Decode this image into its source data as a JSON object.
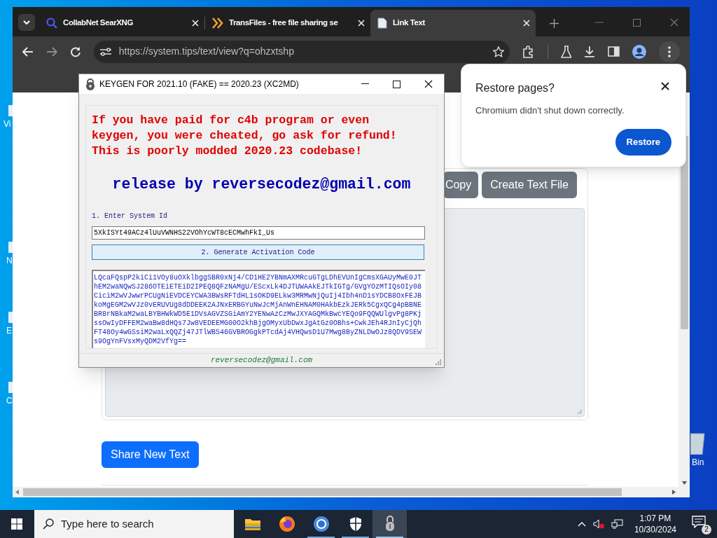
{
  "desktop": {
    "icons": [
      {
        "label": "Vi"
      },
      {
        "label": "N"
      },
      {
        "label": "E"
      },
      {
        "label": "C"
      },
      {
        "label": "Bin"
      }
    ]
  },
  "browser": {
    "tabs": [
      {
        "title": "CollabNet SearXNG",
        "kind": "search",
        "selected": false
      },
      {
        "title": "TransFiles - free file sharing se",
        "kind": "chevrons",
        "selected": false
      },
      {
        "title": "Link Text",
        "kind": "document",
        "selected": true
      }
    ],
    "address": "https://system.tips/text/view?q=ohzxtshp",
    "page": {
      "buttons": [
        "Copy",
        "Create Text File"
      ],
      "share_button": "Share New Text"
    }
  },
  "restore_popup": {
    "title": "Restore pages?",
    "message": "Chromium didn't shut down correctly.",
    "button": "Restore"
  },
  "keygen": {
    "title": "KEYGEN FOR 2021.10 (FAKE) == 2020.23 (XC2MD)",
    "warning": [
      "If you have paid for c4b program or even",
      "keygen, you were cheated, go ask for refund!",
      "This is poorly modded 2020.23 codebase!"
    ],
    "release": "release by reversecodez@gmail.com",
    "system_id_label": "1. Enter System Id",
    "system_id": "5XkISYt49ACz4lUuVWNHS22VOhYcWT8cECMwhFkI_Us",
    "generate_button": "2. Generate Activation Code",
    "activation_code": [
      "LQcaFQspP2kiCi1VOy8uOXklbggSBR0xNj4/CD1HE2YBNmAXMRcuGTgLDhEVUnIgCmsXGAUyMwE0JT",
      "hEM2waNQwSJ286OTEiETEiD2IPEQ8QFzNAMgU/EScxLk4DJTUWAAkEJTkIGTg/GVgYOzMTIQsOIy08",
      "CiciM2wVJwwrPCUgNiEVDCEYCWA3BWsRFTdHL1sOKD9ELkw3MRMwNjQuIj4Ibh4nD1sYDCB8OxFEJB",
      "koMgEGM2wVJz0vERUVUg8dDDEEK2AJNxERBGYuNwJcMjAnWnEHNAM0HAkbEzkJERk5CgxQCg4pBBNE",
      "BR8rNBkaM2waLBYBHWkWD5E1DVsAGVZSGiAmY2YENwAzCzMwJXYAGQMkBwcYEQo9FQQWUlgvPg8PKj",
      "ssOwIyDFFEM2waBw8dHQs7Jw8VEDEEMG00O2khBjgOMyxUbDwxJgAtGz0OBhs+CwkJEh4RJnIyCjQh",
      "FT48Oy4wGSsiM2waLxQQZj47JTlWBS46GVBROGgkPTcdAj4VHQwsD1U7Mwg8ByZNLDwOJz8QDV9SEW",
      "s9OgYnFVsxMyQDM2VfYg=="
    ],
    "status": "reversecodez@gmail.com"
  },
  "taskbar": {
    "search_placeholder": "Type here to search",
    "apps": [
      {
        "kind": "folder",
        "selected": false
      },
      {
        "kind": "firefox",
        "selected": false
      },
      {
        "kind": "chromium",
        "selected": false
      },
      {
        "kind": "shield",
        "selected": false
      },
      {
        "kind": "keygen",
        "selected": true
      }
    ],
    "time": "1:07 PM",
    "date": "10/30/2024",
    "notifications": "2"
  }
}
